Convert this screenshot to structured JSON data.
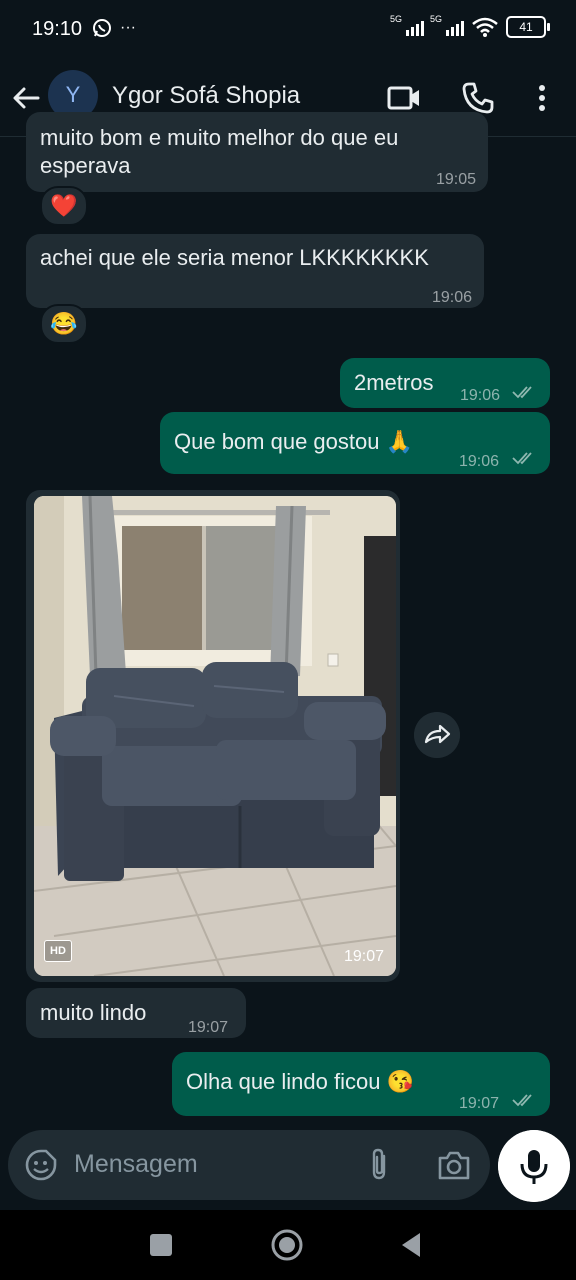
{
  "status_bar": {
    "time": "19:10",
    "more": "···",
    "net1": "5G",
    "net2": "5G",
    "battery": "41"
  },
  "header": {
    "avatar_letter": "Y",
    "contact_name": "Ygor Sofá Shopia"
  },
  "messages": [
    {
      "direction": "in",
      "text": "muito bom e muito melhor do que eu",
      "text2": "esperava",
      "time": "19:05",
      "reaction": "❤️"
    },
    {
      "direction": "in",
      "text": "achei que ele seria menor LKKKKKKKK",
      "time": "19:06",
      "reaction": "😂"
    },
    {
      "direction": "out",
      "text": "2metros",
      "time": "19:06"
    },
    {
      "direction": "out",
      "text": "Que bom que gostou 🙏",
      "time": "19:06"
    },
    {
      "direction": "in",
      "type": "image",
      "badge": "HD",
      "time": "19:07"
    },
    {
      "direction": "in",
      "text": "muito lindo",
      "time": "19:07"
    },
    {
      "direction": "out",
      "text": "Olha que lindo ficou 😘",
      "time": "19:07"
    }
  ],
  "composer": {
    "placeholder": "Mensagem"
  },
  "colors": {
    "background": "#0b141a",
    "incoming": "#202c33",
    "outgoing": "#005c4b",
    "ticks": "#8696a0"
  }
}
